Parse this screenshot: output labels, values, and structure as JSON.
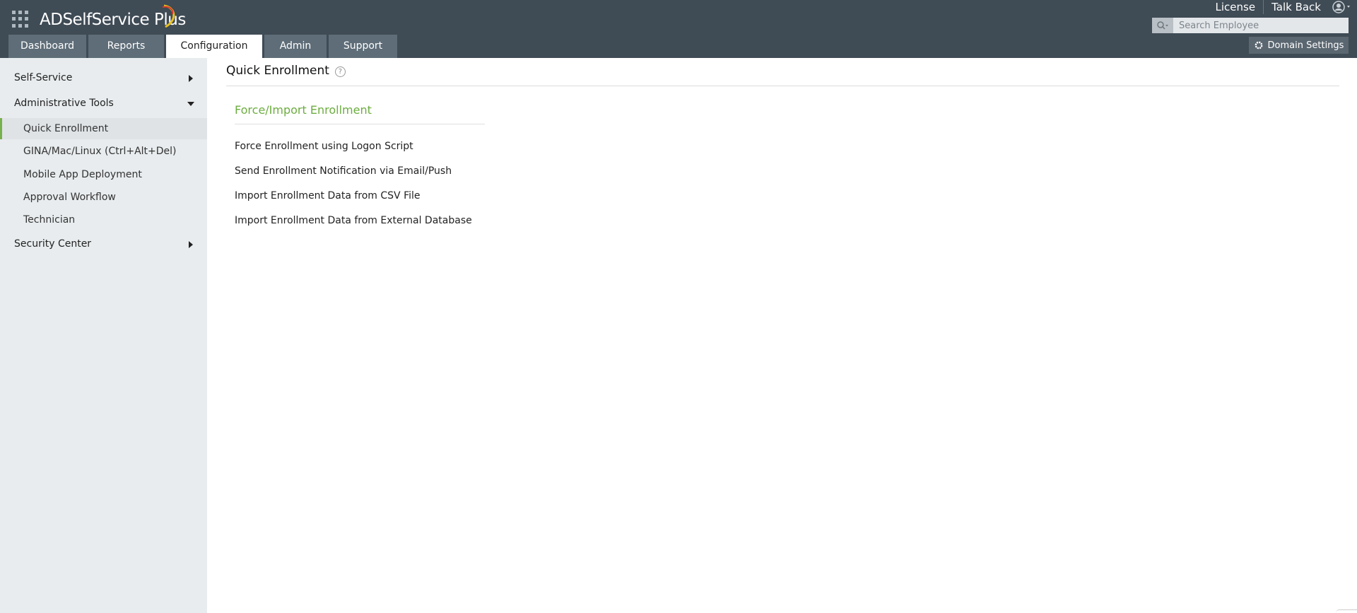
{
  "brand": {
    "name": "ADSelfService Plus"
  },
  "top_links": [
    "License",
    "Talk Back"
  ],
  "search": {
    "placeholder": "Search Employee",
    "value": ""
  },
  "domain_settings": {
    "label": "Domain Settings"
  },
  "tabs": [
    {
      "label": "Dashboard",
      "active": false
    },
    {
      "label": "Reports",
      "active": false
    },
    {
      "label": "Configuration",
      "active": true
    },
    {
      "label": "Admin",
      "active": false
    },
    {
      "label": "Support",
      "active": false
    }
  ],
  "sidebar": {
    "sections": [
      {
        "label": "Self-Service",
        "expanded": false
      },
      {
        "label": "Administrative Tools",
        "expanded": true
      },
      {
        "label": "Security Center",
        "expanded": false
      }
    ],
    "admin_items": [
      {
        "label": "Quick Enrollment",
        "active": true
      },
      {
        "label": "GINA/Mac/Linux (Ctrl+Alt+Del)",
        "active": false
      },
      {
        "label": "Mobile App Deployment",
        "active": false
      },
      {
        "label": "Approval Workflow",
        "active": false
      },
      {
        "label": "Technician",
        "active": false
      }
    ]
  },
  "main": {
    "title": "Quick Enrollment",
    "help_glyph": "?",
    "section_heading": "Force/Import Enrollment",
    "links": [
      "Force Enrollment using Logon Script",
      "Send Enrollment Notification via Email/Push",
      "Import Enrollment Data from CSV File",
      "Import Enrollment Data from External Database"
    ]
  },
  "colors": {
    "header_bg": "#3f4b55",
    "tab_bg": "#5e6d78",
    "accent_green": "#6cad3f",
    "sidebar_bg": "#e8ecee"
  }
}
